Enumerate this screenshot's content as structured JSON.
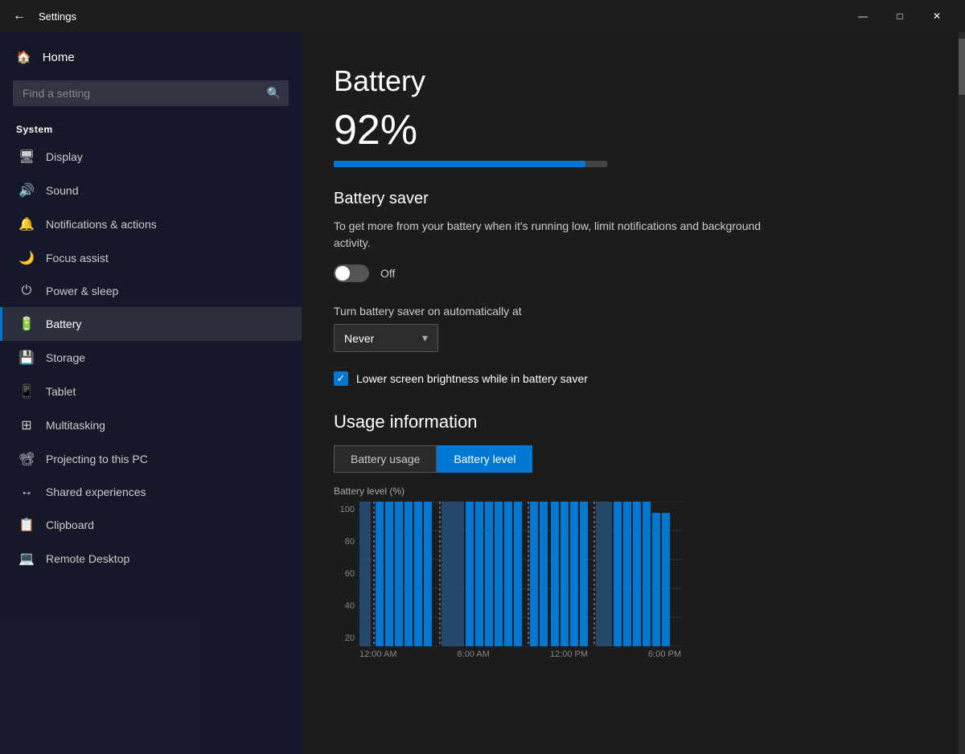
{
  "titlebar": {
    "title": "Settings",
    "back_icon": "←",
    "minimize": "—",
    "maximize": "□",
    "close": "✕"
  },
  "sidebar": {
    "home_label": "Home",
    "search_placeholder": "Find a setting",
    "section_label": "System",
    "items": [
      {
        "id": "display",
        "label": "Display",
        "icon": "🖥"
      },
      {
        "id": "sound",
        "label": "Sound",
        "icon": "🔊"
      },
      {
        "id": "notifications",
        "label": "Notifications & actions",
        "icon": "🔔"
      },
      {
        "id": "focus",
        "label": "Focus assist",
        "icon": "🌙"
      },
      {
        "id": "power",
        "label": "Power & sleep",
        "icon": "⏻"
      },
      {
        "id": "battery",
        "label": "Battery",
        "icon": "🔋",
        "active": true
      },
      {
        "id": "storage",
        "label": "Storage",
        "icon": "💾"
      },
      {
        "id": "tablet",
        "label": "Tablet",
        "icon": "📱"
      },
      {
        "id": "multitasking",
        "label": "Multitasking",
        "icon": "⊞"
      },
      {
        "id": "projecting",
        "label": "Projecting to this PC",
        "icon": "📽"
      },
      {
        "id": "shared",
        "label": "Shared experiences",
        "icon": "↔"
      },
      {
        "id": "clipboard",
        "label": "Clipboard",
        "icon": "📋"
      },
      {
        "id": "remote",
        "label": "Remote Desktop",
        "icon": "💻"
      }
    ]
  },
  "content": {
    "page_title": "Battery",
    "battery_percent": "92%",
    "battery_fill_width": "92",
    "battery_saver_title": "Battery saver",
    "battery_saver_desc": "To get more from your battery when it's running low, limit notifications and background activity.",
    "toggle_state": "Off",
    "auto_label": "Turn battery saver on automatically at",
    "dropdown_value": "Never",
    "checkbox_label": "Lower screen brightness while in battery saver",
    "usage_title": "Usage information",
    "tab_battery_usage": "Battery usage",
    "tab_battery_level": "Battery level",
    "chart_y_label": "Battery level (%)",
    "y_axis": [
      "100",
      "80",
      "60",
      "40",
      "20"
    ],
    "x_axis": [
      "12:00 AM",
      "6:00 AM",
      "12:00 PM",
      "6:00 PM"
    ]
  }
}
